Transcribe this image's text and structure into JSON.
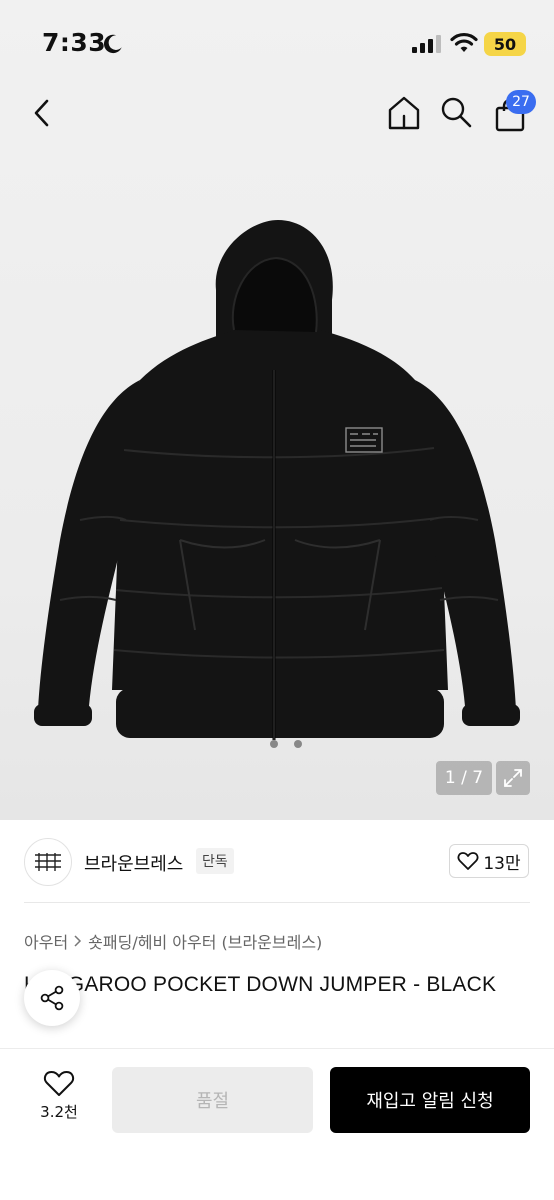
{
  "status_bar": {
    "time": "7:33",
    "battery": "50",
    "icons": [
      "moon-icon",
      "signal-icon",
      "wifi-icon"
    ]
  },
  "nav": {
    "icons": [
      "back-icon",
      "home-icon",
      "search-icon",
      "bag-icon"
    ],
    "cart_count": "27"
  },
  "gallery": {
    "counter": "1 / 7",
    "image_logo_text": "BROWNBREATH"
  },
  "brand": {
    "name": "브라운브레스",
    "badge": "단독",
    "likes": "13만"
  },
  "breadcrumb": {
    "category": "아우터",
    "subcategory": "숏패딩/헤비 아우터 (브라운브레스)"
  },
  "product": {
    "title": "KANGAROO POCKET DOWN JUMPER - BLACK",
    "title_visible": "K        GAROO POCKET DOWN JUMPER - B L   CK"
  },
  "bottom_bar": {
    "wish_count": "3.2천",
    "soldout_label": "품절",
    "restock_label": "재입고 알림 신청"
  },
  "colors": {
    "accent_badge": "#3a6df0",
    "primary_button": "#000000",
    "battery": "#f5d547"
  }
}
